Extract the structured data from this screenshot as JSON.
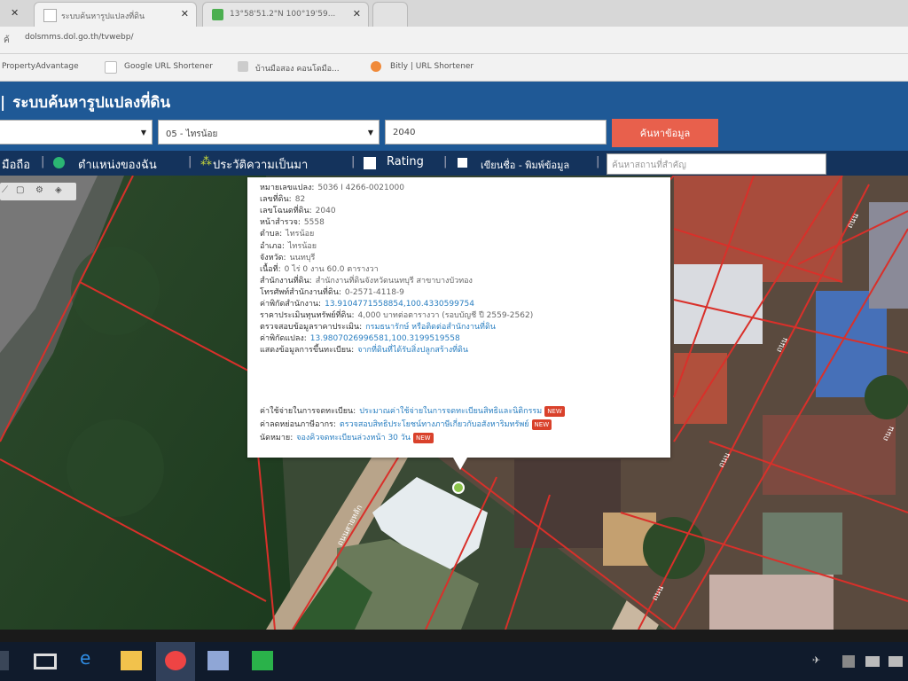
{
  "browser": {
    "tabs": [
      {
        "title": "ระบบค้นหารูปแปลงที่ดิน"
      },
      {
        "title": "13°58'51.2\"N 100°19'59..."
      }
    ],
    "url": "dolsmms.dol.go.th/tvwebp/",
    "bookmarks": [
      {
        "label": "PropertyAdvantage"
      },
      {
        "label": "Google URL Shortener"
      },
      {
        "label": "บ้านมือสอง คอนโดมือ..."
      },
      {
        "label": "Bitly | URL Shortener"
      }
    ]
  },
  "app": {
    "title": "ระบบค้นหารูปแปลงที่ดิน",
    "search": {
      "province_value": "",
      "district_value": "05 - ไทรน้อย",
      "parcel_value": "2040",
      "button_label": "ค้นหาข้อมูล"
    },
    "toolbar": {
      "item1": "มือถือ",
      "item2": "ตำแหน่งของฉัน",
      "item3": "ประวัติความเป็นมา",
      "item4": "Rating",
      "item5": "เขียนชื่อ - พิมพ์ข้อมูล",
      "filter_placeholder": "ค้นหาสถานที่สำคัญ"
    }
  },
  "popup": {
    "rows": [
      {
        "label": "หมายเลขแปลง:",
        "value": "5036 I 4266-0021000"
      },
      {
        "label": "เลขที่ดิน:",
        "value": "82"
      },
      {
        "label": "เลขโฉนดที่ดิน:",
        "value": "2040"
      },
      {
        "label": "หน้าสำรวจ:",
        "value": "5558"
      },
      {
        "label": "ตำบล:",
        "value": "ไทรน้อย"
      },
      {
        "label": "อำเภอ:",
        "value": "ไทรน้อย"
      },
      {
        "label": "จังหวัด:",
        "value": "นนทบุรี"
      },
      {
        "label": "เนื้อที่:",
        "value": "0 ไร่ 0 งาน 60.0 ตารางวา"
      },
      {
        "label": "สำนักงานที่ดิน:",
        "value": "สำนักงานที่ดินจังหวัดนนทบุรี สาขาบางบัวทอง"
      },
      {
        "label": "โทรศัพท์สำนักงานที่ดิน:",
        "value": "0-2571-4118-9"
      },
      {
        "label": "ค่าพิกัดสำนักงาน:",
        "value": "13.9104771558854,100.4330599754",
        "link": true
      },
      {
        "label": "ราคาประเมินทุนทรัพย์ที่ดิน:",
        "value": "4,000 บาทต่อตารางวา (รอบบัญชี ปี 2559-2562)"
      },
      {
        "label": "ตรวจสอบข้อมูลราคาประเมิน:",
        "value": "กรมธนารักษ์ หรือติดต่อสำนักงานที่ดิน",
        "link": true
      },
      {
        "label": "ค่าพิกัดแปลง:",
        "value": "13.9807026996581,100.3199519558",
        "link": true
      },
      {
        "label": "แสดงข้อมูลการขึ้นทะเบียน:",
        "value": "จากที่ดินที่ได้รับสิ่งปลูกสร้างที่ดิน",
        "link": true
      }
    ],
    "services": [
      {
        "label": "ค่าใช้จ่ายในการจดทะเบียน:",
        "value": "ประมาณค่าใช้จ่ายในการจดทะเบียนสิทธิและนิติกรรม",
        "badge": "NEW"
      },
      {
        "label": "ค่าลดหย่อนภาษีอากร:",
        "value": "ตรวจสอบสิทธิประโยชน์ทางภาษีเกี่ยวกับอสังหาริมทรัพย์",
        "badge": "NEW"
      },
      {
        "label": "นัดหมาย:",
        "value": "จองคิวจดทะเบียนล่วงหน้า 30 วัน",
        "badge": "NEW"
      }
    ]
  },
  "map": {
    "road_labels": [
      "ถนนสายหลัก",
      "ถนน",
      "ถนน",
      "ถนน",
      "ถนน",
      "ถนน"
    ]
  },
  "colors": {
    "header": "#1f5996",
    "toolbar": "#14335c",
    "search_button": "#e8604c",
    "parcel_line": "#d9302a",
    "taskbar": "#101b2c"
  }
}
